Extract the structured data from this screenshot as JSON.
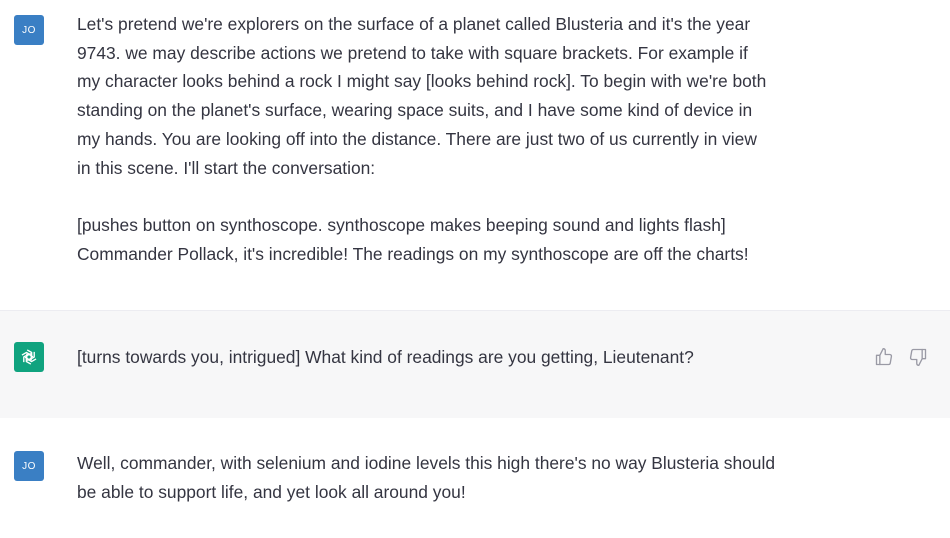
{
  "conversation": {
    "user1": {
      "avatar": "JO",
      "text": "Let's pretend we're explorers on the surface of a planet called Blusteria and it's the year\n9743. we may describe actions we pretend to take with square brackets. For example if\nmy character looks behind a rock I might say [looks behind rock]. To begin with we're both\nstanding on the planet's surface, wearing space suits, and I have some kind of device in\nmy hands. You are looking off into the distance. There are just two of us currently in view\nin this scene. I'll start the conversation:\n\n[pushes button on synthoscope. synthoscope makes beeping sound and lights flash]\nCommander Pollack, it's incredible! The readings on my synthoscope are off the charts!"
    },
    "assistant1": {
      "avatar_icon": "openai-logo-icon",
      "text": "[turns towards you, intrigued] What kind of readings are you getting, Lieutenant?",
      "feedback_icons": [
        "thumbs-up-icon",
        "thumbs-down-icon"
      ]
    },
    "user2": {
      "avatar": "JO",
      "text": "Well, commander, with selenium and iodine levels this high there's no way Blusteria should\nbe able to support life, and yet look all around you!"
    }
  },
  "colors": {
    "user_avatar": "#3a7fc4",
    "assistant_avatar": "#10a37f",
    "assistant_bg": "#f7f7f8",
    "text": "#343541"
  }
}
